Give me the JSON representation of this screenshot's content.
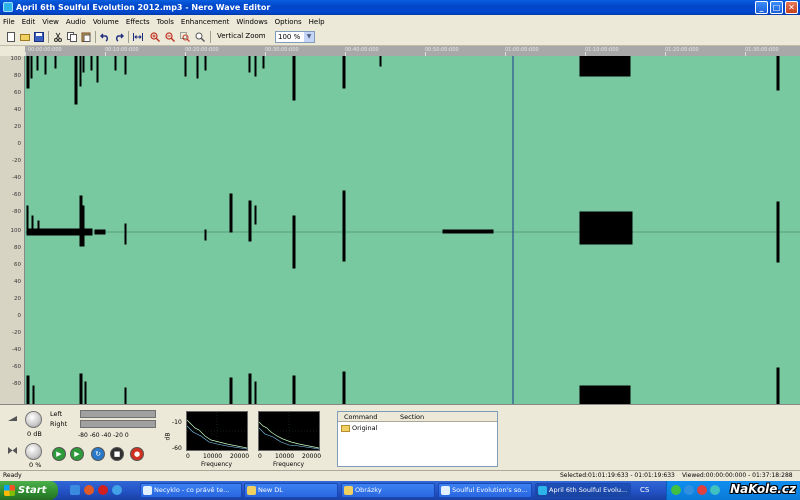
{
  "window": {
    "title": "April 6th Soulful Evolution 2012.mp3 - Nero Wave Editor",
    "min_glyph": "_",
    "max_glyph": "□",
    "close_glyph": "✕"
  },
  "menu": [
    "File",
    "Edit",
    "View",
    "Audio",
    "Volume",
    "Effects",
    "Tools",
    "Enhancement",
    "Windows",
    "Options",
    "Help"
  ],
  "toolbar": {
    "vertical_zoom_label": "Vertical Zoom",
    "vertical_zoom_value": "100 %"
  },
  "ruler": {
    "labels": [
      "00:00:00:000",
      "00:10:00:000",
      "00:20:00:000",
      "00:30:00:000",
      "00:40:00:000",
      "00:50:00:000",
      "01:00:00:000",
      "01:10:00:000",
      "01:20:00:000",
      "01:30:00:000"
    ]
  },
  "amplitude_scale": {
    "labels": [
      "100",
      "80",
      "60",
      "40",
      "20",
      "0",
      "-20",
      "-40",
      "-60",
      "-80",
      "100",
      "80",
      "60",
      "40",
      "20",
      "0",
      "-20",
      "-40",
      "-60",
      "-80"
    ]
  },
  "levels": {
    "left_label": "Left",
    "right_label": "Right",
    "scale": "-80  -60  -40  -20    0",
    "volume_value": "0 dB",
    "pan_value": "0 %"
  },
  "spectrum": {
    "db_top": "-10",
    "db_bottom": "-60",
    "db_unit": "dB",
    "freq_ticks": [
      "0",
      "10000",
      "20000"
    ],
    "freq_label": "Frequency"
  },
  "commands": {
    "col_command": "Command",
    "col_section": "Section",
    "rows": [
      "Original"
    ]
  },
  "status": {
    "left": "Ready",
    "selected": "Selected:01:01:19:633 - 01:01:19:633",
    "viewed": "Viewed:00:00:00:000 - 01:37:18:288"
  },
  "taskbar": {
    "start": "Start",
    "tasks": [
      "Necyklo - co právě te...",
      "New DL",
      "Obrázky",
      "Soulful Evolution's so...",
      "April 6th Soulful Evolu..."
    ],
    "lang": "CS",
    "watermark": "NaKole.cz"
  },
  "colors": {
    "waveform_bg": "#78c8a0",
    "waveform": "#000000",
    "cursor": "#1a3a8c"
  }
}
